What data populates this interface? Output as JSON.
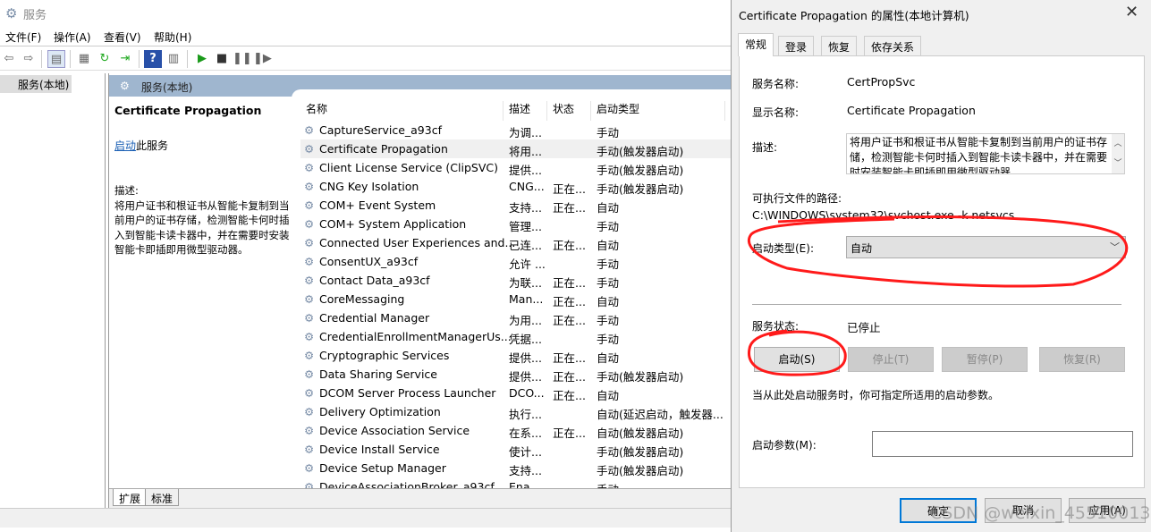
{
  "window": {
    "title": "服务",
    "icon": "gear-icon"
  },
  "menu": [
    "文件(F)",
    "操作(A)",
    "查看(V)",
    "帮助(H)"
  ],
  "toolbar": [
    "back-icon",
    "forward-icon",
    "show-hide-console-tree-icon",
    "properties-icon",
    "refresh-icon",
    "export-list-icon",
    "help-icon",
    "show-action-pane-icon",
    "start-service-icon",
    "stop-service-icon",
    "pause-service-icon",
    "resume-service-icon"
  ],
  "tree": {
    "item": "服务(本地)"
  },
  "pane": {
    "header": "服务(本地)",
    "detail": {
      "name": "Certificate Propagation",
      "start_link": "启动",
      "start_suffix": "此服务",
      "desc_label": "描述:",
      "desc": "将用户证书和根证书从智能卡复制到当前用户的证书存储，检测智能卡何时插入到智能卡读卡器中，并在需要时安装智能卡即插即用微型驱动器。"
    },
    "columns": [
      "名称",
      "描述",
      "状态",
      "启动类型"
    ],
    "rows": [
      {
        "name": "CaptureService_a93cf",
        "desc": "为调...",
        "status": "",
        "startup": "手动"
      },
      {
        "name": "Certificate Propagation",
        "desc": "将用...",
        "status": "",
        "startup": "手动(触发器启动)",
        "selected": true
      },
      {
        "name": "Client License Service (ClipSVC)",
        "desc": "提供...",
        "status": "",
        "startup": "手动(触发器启动)"
      },
      {
        "name": "CNG Key Isolation",
        "desc": "CNG...",
        "status": "正在...",
        "startup": "手动(触发器启动)"
      },
      {
        "name": "COM+ Event System",
        "desc": "支持...",
        "status": "正在...",
        "startup": "自动"
      },
      {
        "name": "COM+ System Application",
        "desc": "管理...",
        "status": "",
        "startup": "手动"
      },
      {
        "name": "Connected User Experiences and...",
        "desc": "已连...",
        "status": "正在...",
        "startup": "自动"
      },
      {
        "name": "ConsentUX_a93cf",
        "desc": "允许 ...",
        "status": "",
        "startup": "手动"
      },
      {
        "name": "Contact Data_a93cf",
        "desc": "为联...",
        "status": "正在...",
        "startup": "手动"
      },
      {
        "name": "CoreMessaging",
        "desc": "Man...",
        "status": "正在...",
        "startup": "自动"
      },
      {
        "name": "Credential Manager",
        "desc": "为用...",
        "status": "正在...",
        "startup": "手动"
      },
      {
        "name": "CredentialEnrollmentManagerUs...",
        "desc": "凭据...",
        "status": "",
        "startup": "手动"
      },
      {
        "name": "Cryptographic Services",
        "desc": "提供...",
        "status": "正在...",
        "startup": "自动"
      },
      {
        "name": "Data Sharing Service",
        "desc": "提供...",
        "status": "正在...",
        "startup": "手动(触发器启动)"
      },
      {
        "name": "DCOM Server Process Launcher",
        "desc": "DCO...",
        "status": "正在...",
        "startup": "自动"
      },
      {
        "name": "Delivery Optimization",
        "desc": "执行...",
        "status": "",
        "startup": "自动(延迟启动，触发器..."
      },
      {
        "name": "Device Association Service",
        "desc": "在系...",
        "status": "正在...",
        "startup": "自动(触发器启动)"
      },
      {
        "name": "Device Install Service",
        "desc": "使计...",
        "status": "",
        "startup": "手动(触发器启动)"
      },
      {
        "name": "Device Setup Manager",
        "desc": "支持...",
        "status": "",
        "startup": "手动(触发器启动)"
      },
      {
        "name": "DeviceAssociationBroker_a93cf",
        "desc": "Ena...",
        "status": "",
        "startup": "手动"
      }
    ],
    "bottom_tabs": [
      "扩展",
      "标准"
    ]
  },
  "dialog": {
    "title": "Certificate Propagation 的属性(本地计算机)",
    "tabs": [
      "常规",
      "登录",
      "恢复",
      "依存关系"
    ],
    "service_name_label": "服务名称:",
    "service_name": "CertPropSvc",
    "display_name_label": "显示名称:",
    "display_name": "Certificate Propagation",
    "desc_label": "描述:",
    "desc": "将用户证书和根证书从智能卡复制到当前用户的证书存储，检测智能卡何时插入到智能卡读卡器中，并在需要时安装智能卡即插即用微型驱动器",
    "path_label": "可执行文件的路径:",
    "path": "C:\\WINDOWS\\system32\\svchost.exe -k netsvcs",
    "startup_label": "启动类型(E):",
    "startup_value": "自动",
    "status_label": "服务状态:",
    "status_value": "已停止",
    "buttons": {
      "start": "启动(S)",
      "stop": "停止(T)",
      "pause": "暂停(P)",
      "resume": "恢复(R)"
    },
    "hint": "当从此处启动服务时，你可指定所适用的启动参数。",
    "param_label": "启动参数(M):",
    "param_value": "",
    "ok": "确定",
    "cancel": "取消",
    "apply": "应用(A)"
  },
  "watermark": "CSDN @weixin_45510013",
  "annotation_color": "#ff0000"
}
